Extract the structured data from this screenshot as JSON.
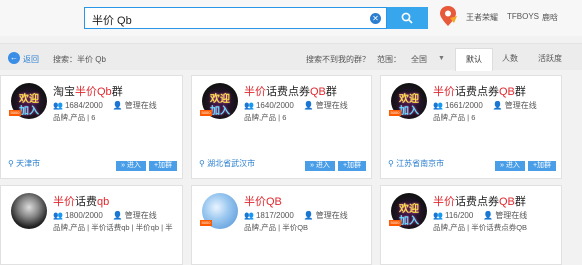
{
  "topbar": {
    "search_value": "半价 Qb",
    "hot": [
      "王者荣耀",
      "TFBOYS",
      "鹿晗"
    ]
  },
  "filter": {
    "back_label": "返回",
    "search_label": "搜索：半价 Qb",
    "not_found": "搜索不到我的群？",
    "range_label": "范围：",
    "range_value": "全国",
    "tabs": [
      "默认",
      "人数",
      "活跃度"
    ]
  },
  "cards": [
    {
      "title_pre": "淘宝",
      "title_hl": "半价Qb",
      "title_post": "群",
      "members": "1684/2000",
      "admin": "管理在线",
      "tags": "品牌,产品 | 6",
      "location": "天津市",
      "enter": "» 进入",
      "add": "+加群",
      "avatar": "group"
    },
    {
      "title_pre": "",
      "title_hl": "半价",
      "title_post": "话费点券",
      "title_hl2": "QB",
      "title_post2": "群",
      "members": "1640/2000",
      "admin": "管理在线",
      "tags": "品牌,产品 | 6",
      "location": "湖北省武汉市",
      "enter": "» 进入",
      "add": "+加群",
      "avatar": "group"
    },
    {
      "title_pre": "",
      "title_hl": "半价",
      "title_post": "话费点券",
      "title_hl2": "QB",
      "title_post2": "群",
      "members": "1661/2000",
      "admin": "管理在线",
      "tags": "品牌,产品 | 6",
      "location": "江苏省南京市",
      "enter": "» 进入",
      "add": "+加群",
      "avatar": "group"
    },
    {
      "title_pre": "",
      "title_hl": "半价",
      "title_post": "话费",
      "title_hl2": "qb",
      "title_post2": "",
      "members": "1800/2000",
      "admin": "管理在线",
      "tags": "品牌,产品 | 半价话费qb | 半价qb | 半",
      "location": "",
      "enter": "",
      "add": "",
      "avatar": "person"
    },
    {
      "title_pre": "",
      "title_hl": "半价QB",
      "title_post": "",
      "members": "1817/2000",
      "admin": "管理在线",
      "tags": "品牌,产品 | 半价QB",
      "location": "",
      "enter": "",
      "add": "",
      "avatar": "blue"
    },
    {
      "title_pre": "",
      "title_hl": "半价",
      "title_post": "话费点券",
      "title_hl2": "QB",
      "title_post2": "群",
      "members": "116/200",
      "admin": "管理在线",
      "tags": "品牌,产品 | 半价话费点券QB",
      "location": "",
      "enter": "",
      "add": "",
      "avatar": "group"
    }
  ],
  "avatar_text": {
    "line1": "欢迎",
    "line2": "加入",
    "badge": "5000"
  },
  "colors": {
    "accent": "#2b95e8",
    "highlight": "#e0282e",
    "link": "#2b7fd0"
  }
}
